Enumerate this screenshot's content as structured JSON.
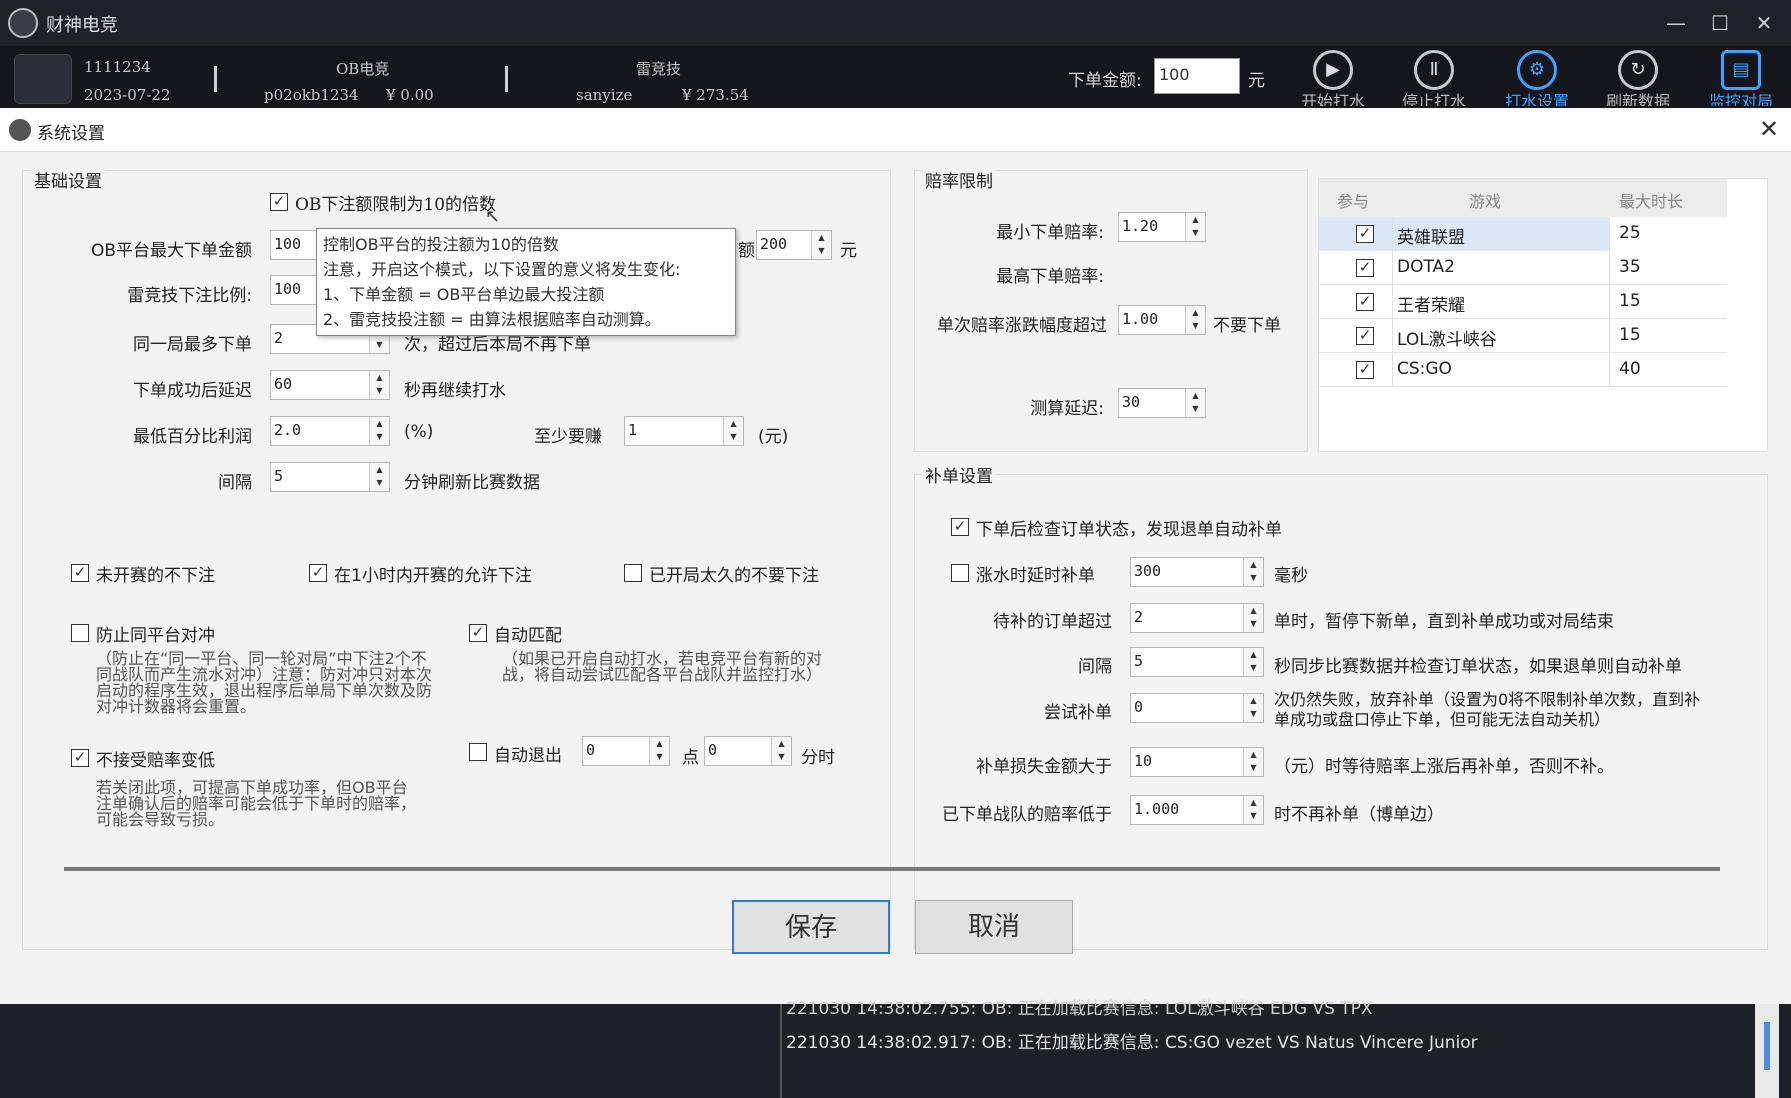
{
  "window": {
    "title": "财神电竞",
    "logo_icon": "app-logo-icon",
    "minimize": "—",
    "maximize": "☐",
    "close": "✕"
  },
  "header": {
    "user_id": "1111234",
    "date": "2023-07-22",
    "platform1": {
      "name": "OB电竞",
      "account": "p02okb1234",
      "balance": "¥ 0.00"
    },
    "platform2": {
      "name": "雷竞技",
      "account": "sanyize",
      "balance": "¥ 273.54"
    },
    "amount_label": "下单金额:",
    "amount_value": "100",
    "amount_unit": "元",
    "tools": [
      {
        "label": "开始打水",
        "icon": "play-icon",
        "glyph": "▶"
      },
      {
        "label": "停止打水",
        "icon": "pause-icon",
        "glyph": "Ⅱ"
      },
      {
        "label": "打水设置",
        "icon": "gear-icon",
        "glyph": "⚙"
      },
      {
        "label": "刷新数据",
        "icon": "refresh-icon",
        "glyph": "↻"
      },
      {
        "label": "监控对局",
        "icon": "monitor-icon",
        "glyph": "▤"
      }
    ],
    "accent_color": "#3da2ff"
  },
  "dialog": {
    "title": "系统设置",
    "close": "✕",
    "basic": {
      "title": "基础设置",
      "ob_multiple_label": "OB下注额限制为10的倍数",
      "ob_max_label": "OB平台最大下单金额",
      "ob_max_value": "100",
      "max_amount_right_value": "200",
      "max_amount_right_prefix": "额",
      "max_amount_right_unit": "元",
      "lei_ratio_label": "雷竞技下注比例:",
      "lei_ratio_value": "100",
      "same_round_label": "同一局最多下单",
      "same_round_value": "2",
      "same_round_suffix": "次，超过后本局不再下单",
      "delay_label": "下单成功后延迟",
      "delay_value": "60",
      "delay_suffix": "秒再继续打水",
      "min_profit_label": "最低百分比利润",
      "min_profit_value": "2.0",
      "min_profit_unit": "(%)",
      "min_earn_label": "至少要赚",
      "min_earn_value": "1",
      "min_earn_unit": "(元)",
      "interval_label": "间隔",
      "interval_value": "5",
      "interval_suffix": "分钟刷新比赛数据",
      "not_started_label": "未开赛的不下注",
      "within_hour_label": "在1小时内开赛的允许下注",
      "started_long_label": "已开局太久的不要下注",
      "prevent_hedge_label": "防止同平台对冲",
      "prevent_hedge_hint": "（防止在“同一平台、同一轮对局”中下注2个不同战队而产生流水对冲）注意：防对冲只对本次启动的程序生效，退出程序后单局下单次数及防对冲计数器将会重置。",
      "auto_match_label": "自动匹配",
      "auto_match_hint": "（如果已开启自动打水，若电竞平台有新的对战，将自动尝试匹配各平台战队并监控打水）",
      "no_odds_drop_label": "不接受赔率变低",
      "no_odds_drop_hint": "若关闭此项，可提高下单成功率，但OB平台注单确认后的赔率可能会低于下单时的赔率，可能会导致亏损。",
      "auto_exit_label": "自动退出",
      "auto_exit_hour": "0",
      "auto_exit_point": "点",
      "auto_exit_min": "0",
      "auto_exit_suffix": "分时"
    },
    "tooltip": {
      "line1": "控制OB平台的投注额为10的倍数",
      "line2": "注意，开启这个模式，以下设置的意义将发生变化:",
      "line3": "1、下单金额 = OB平台单边最大投注额",
      "line4": "2、雷竞技投注额 = 由算法根据赔率自动测算。"
    },
    "odds": {
      "title": "赔率限制",
      "min_label": "最小下单赔率:",
      "min_value": "1.20",
      "max_label": "最高下单赔率:",
      "change_label": "单次赔率涨跌幅度超过",
      "change_value": "1.00",
      "change_suffix": "不要下单",
      "calc_delay_label": "测算延迟:",
      "calc_delay_value": "30"
    },
    "games": {
      "headers": [
        "参与",
        "游戏",
        "最大时长"
      ],
      "rows": [
        {
          "checked": true,
          "name": "英雄联盟",
          "max": "25"
        },
        {
          "checked": true,
          "name": "DOTA2",
          "max": "35"
        },
        {
          "checked": true,
          "name": "王者荣耀",
          "max": "15"
        },
        {
          "checked": true,
          "name": "LOL激斗峡谷",
          "max": "15"
        },
        {
          "checked": true,
          "name": "CS:GO",
          "max": "40"
        }
      ]
    },
    "supplement": {
      "title": "补单设置",
      "check_status_label": "下单后检查订单状态，发现退单自动补单",
      "rise_delay_label": "涨水时延时补单",
      "rise_delay_value": "300",
      "rise_delay_unit": "毫秒",
      "pending_label": "待补的订单超过",
      "pending_value": "2",
      "pending_suffix": "单时，暂停下新单，直到补单成功或对局结束",
      "interval_label": "间隔",
      "interval_value": "5",
      "interval_suffix": "秒同步比赛数据并检查订单状态，如果退单则自动补单",
      "retry_label": "尝试补单",
      "retry_value": "0",
      "retry_suffix": "次仍然失败，放弃补单（设置为0将不限制补单次数，直到补单成功或盘口停止下单，但可能无法自动关机）",
      "loss_label": "补单损失金额大于",
      "loss_value": "10",
      "loss_suffix": "（元）时等待赔率上涨后再补单，否则不补。",
      "odds_below_label": "已下单战队的赔率低于",
      "odds_below_value": "1.000",
      "odds_below_suffix": "时不再补单（博单边）"
    },
    "save_label": "保存",
    "cancel_label": "取消",
    "primary_color": "#2a7fd4"
  },
  "log": {
    "lines": [
      "221030 14:38:02.755:  OB:  正在加载比赛信息:  LOL激斗峡谷 EDG VS TPX",
      "221030 14:38:02.917:  OB:  正在加载比赛信息:  CS:GO vezet VS Natus Vincere Junior"
    ]
  }
}
